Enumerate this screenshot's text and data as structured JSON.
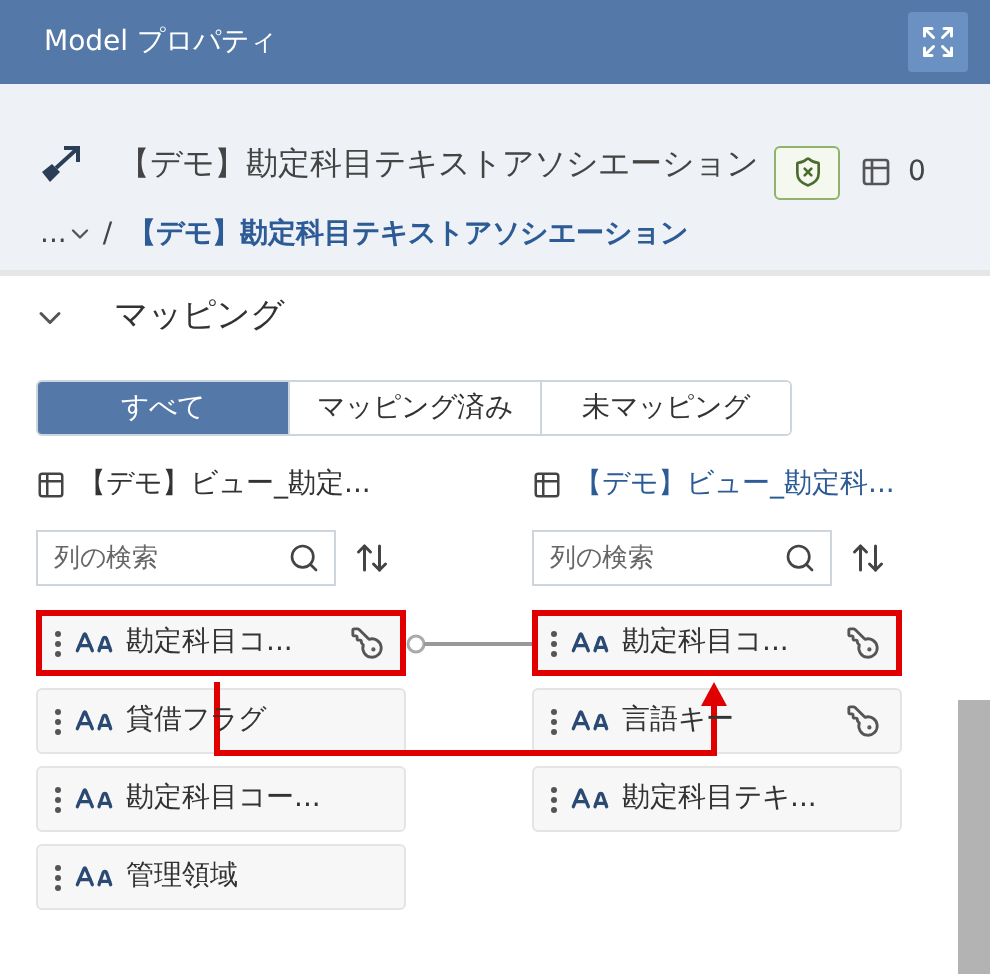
{
  "header": {
    "title": "Model プロパティ"
  },
  "object": {
    "title": "【デモ】勘定科目テキストアソシエーション",
    "count": "0"
  },
  "breadcrumb": {
    "ellipsis": "...",
    "separator": "/",
    "current": "【デモ】勘定科目テキストアソシエーション"
  },
  "section": {
    "title": "マッピング",
    "expanded": true
  },
  "filters": [
    {
      "label": "すべて",
      "selected": true
    },
    {
      "label": "マッピング済み",
      "selected": false
    },
    {
      "label": "未マッピング",
      "selected": false
    }
  ],
  "source": {
    "title": "【デモ】ビュー_勘定...",
    "placeholder": "列の検索",
    "columns": [
      {
        "name": "勘定科目コ...",
        "key": true,
        "mapped": true,
        "highlighted": true
      },
      {
        "name": "貸借フラグ",
        "key": false,
        "mapped": false,
        "highlighted": false
      },
      {
        "name": "勘定科目コー...",
        "key": false,
        "mapped": false,
        "highlighted": false
      },
      {
        "name": "管理領域",
        "key": false,
        "mapped": false,
        "highlighted": false
      }
    ]
  },
  "target": {
    "title": "【デモ】ビュー_勘定科...",
    "placeholder": "列の検索",
    "columns": [
      {
        "name": "勘定科目コ...",
        "key": true,
        "highlighted": true
      },
      {
        "name": "言語キー",
        "key": true,
        "highlighted": false
      },
      {
        "name": "勘定科目テキ...",
        "key": false,
        "highlighted": false
      }
    ]
  },
  "annotation_arrow": true
}
